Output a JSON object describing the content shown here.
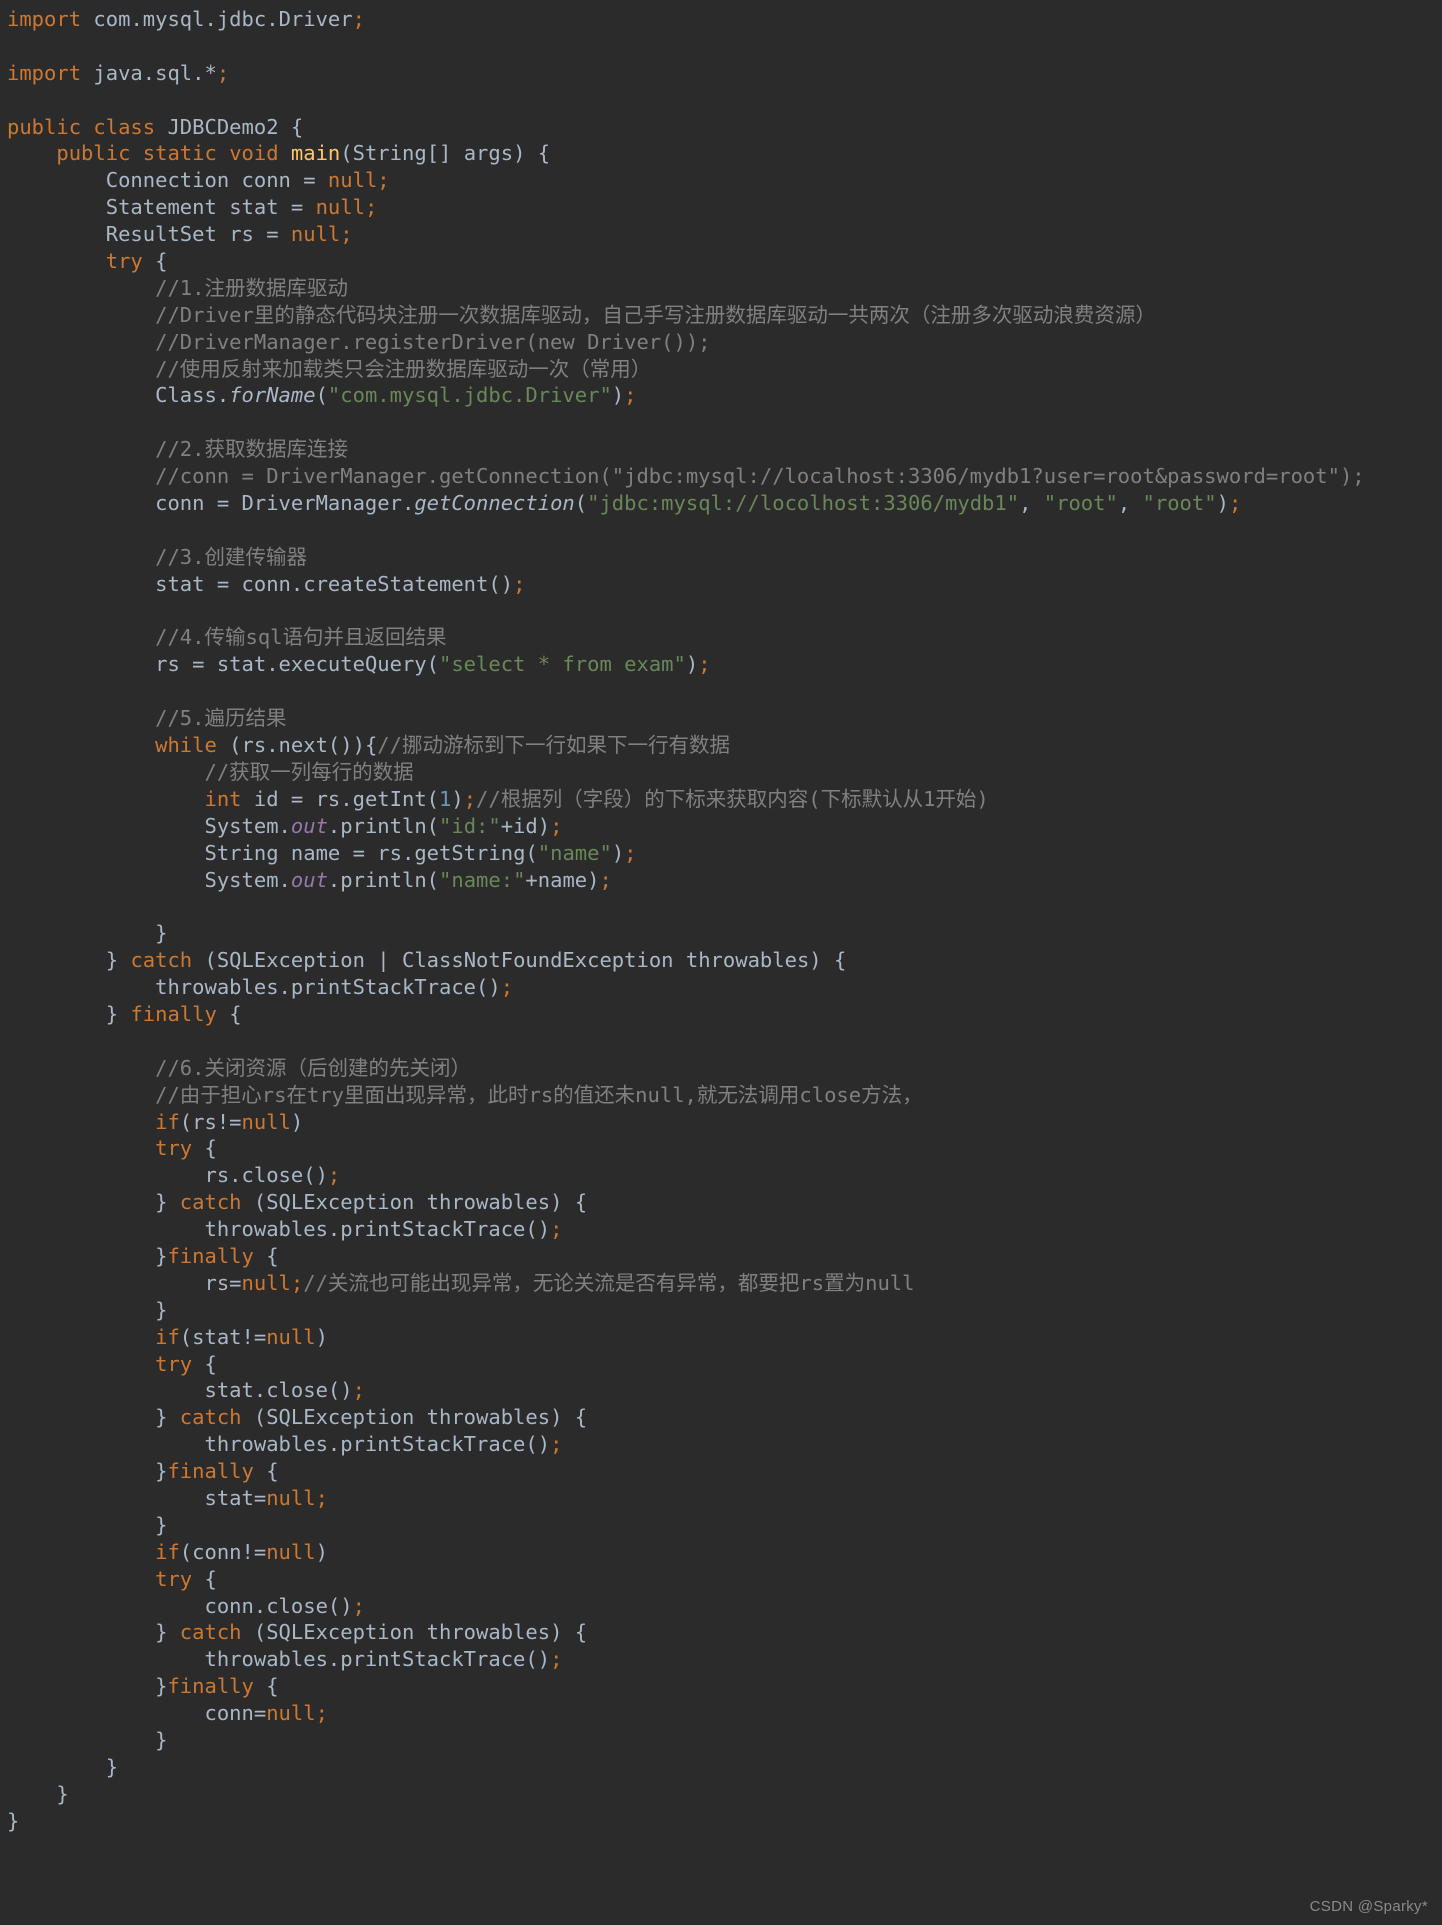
{
  "editor": {
    "language": "java",
    "theme": "darcula",
    "background_color": "#2b2b2b",
    "colors": {
      "default_text": "#a9b7c6",
      "keyword": "#cc7832",
      "string": "#6a8759",
      "comment": "#808080",
      "number": "#6897bb",
      "method_declaration": "#ffc66d",
      "static_field": "#9876aa"
    },
    "lines": [
      {
        "n": 1,
        "text": "import com.mysql.jdbc.Driver;"
      },
      {
        "n": 2,
        "text": ""
      },
      {
        "n": 3,
        "text": "import java.sql.*;"
      },
      {
        "n": 4,
        "text": ""
      },
      {
        "n": 5,
        "text": "public class JDBCDemo2 {"
      },
      {
        "n": 6,
        "text": "    public static void main(String[] args) {"
      },
      {
        "n": 7,
        "text": "        Connection conn = null;"
      },
      {
        "n": 8,
        "text": "        Statement stat = null;"
      },
      {
        "n": 9,
        "text": "        ResultSet rs = null;"
      },
      {
        "n": 10,
        "text": "        try {"
      },
      {
        "n": 11,
        "text": "            //1.注册数据库驱动"
      },
      {
        "n": 12,
        "text": "            //Driver里的静态代码块注册一次数据库驱动，自己手写注册数据库驱动一共两次（注册多次驱动浪费资源）"
      },
      {
        "n": 13,
        "text": "            //DriverManager.registerDriver(new Driver());"
      },
      {
        "n": 14,
        "text": "            //使用反射来加载类只会注册数据库驱动一次（常用）"
      },
      {
        "n": 15,
        "text": "            Class.forName(\"com.mysql.jdbc.Driver\");"
      },
      {
        "n": 16,
        "text": ""
      },
      {
        "n": 17,
        "text": "            //2.获取数据库连接"
      },
      {
        "n": 18,
        "text": "            //conn = DriverManager.getConnection(\"jdbc:mysql://localhost:3306/mydb1?user=root&password=root\");"
      },
      {
        "n": 19,
        "text": "            conn = DriverManager.getConnection(\"jdbc:mysql://locolhost:3306/mydb1\", \"root\", \"root\");"
      },
      {
        "n": 20,
        "text": ""
      },
      {
        "n": 21,
        "text": "            //3.创建传输器"
      },
      {
        "n": 22,
        "text": "            stat = conn.createStatement();"
      },
      {
        "n": 23,
        "text": ""
      },
      {
        "n": 24,
        "text": "            //4.传输sql语句并且返回结果"
      },
      {
        "n": 25,
        "text": "            rs = stat.executeQuery(\"select * from exam\");"
      },
      {
        "n": 26,
        "text": ""
      },
      {
        "n": 27,
        "text": "            //5.遍历结果"
      },
      {
        "n": 28,
        "text": "            while (rs.next()){//挪动游标到下一行如果下一行有数据"
      },
      {
        "n": 29,
        "text": "                //获取一列每行的数据"
      },
      {
        "n": 30,
        "text": "                int id = rs.getInt(1);//根据列（字段）的下标来获取内容(下标默认从1开始)"
      },
      {
        "n": 31,
        "text": "                System.out.println(\"id:\"+id);"
      },
      {
        "n": 32,
        "text": "                String name = rs.getString(\"name\");"
      },
      {
        "n": 33,
        "text": "                System.out.println(\"name:\"+name);"
      },
      {
        "n": 34,
        "text": ""
      },
      {
        "n": 35,
        "text": "            }"
      },
      {
        "n": 36,
        "text": "        } catch (SQLException | ClassNotFoundException throwables) {"
      },
      {
        "n": 37,
        "text": "            throwables.printStackTrace();"
      },
      {
        "n": 38,
        "text": "        } finally {"
      },
      {
        "n": 39,
        "text": ""
      },
      {
        "n": 40,
        "text": "            //6.关闭资源（后创建的先关闭）"
      },
      {
        "n": 41,
        "text": "            //由于担心rs在try里面出现异常，此时rs的值还未null,就无法调用close方法，"
      },
      {
        "n": 42,
        "text": "            if(rs!=null)"
      },
      {
        "n": 43,
        "text": "            try {"
      },
      {
        "n": 44,
        "text": "                rs.close();"
      },
      {
        "n": 45,
        "text": "            } catch (SQLException throwables) {"
      },
      {
        "n": 46,
        "text": "                throwables.printStackTrace();"
      },
      {
        "n": 47,
        "text": "            }finally {"
      },
      {
        "n": 48,
        "text": "                rs=null;//关流也可能出现异常，无论关流是否有异常，都要把rs置为null"
      },
      {
        "n": 49,
        "text": "            }"
      },
      {
        "n": 50,
        "text": "            if(stat!=null)"
      },
      {
        "n": 51,
        "text": "            try {"
      },
      {
        "n": 52,
        "text": "                stat.close();"
      },
      {
        "n": 53,
        "text": "            } catch (SQLException throwables) {"
      },
      {
        "n": 54,
        "text": "                throwables.printStackTrace();"
      },
      {
        "n": 55,
        "text": "            }finally {"
      },
      {
        "n": 56,
        "text": "                stat=null;"
      },
      {
        "n": 57,
        "text": "            }"
      },
      {
        "n": 58,
        "text": "            if(conn!=null)"
      },
      {
        "n": 59,
        "text": "            try {"
      },
      {
        "n": 60,
        "text": "                conn.close();"
      },
      {
        "n": 61,
        "text": "            } catch (SQLException throwables) {"
      },
      {
        "n": 62,
        "text": "                throwables.printStackTrace();"
      },
      {
        "n": 63,
        "text": "            }finally {"
      },
      {
        "n": 64,
        "text": "                conn=null;"
      },
      {
        "n": 65,
        "text": "            }"
      },
      {
        "n": 66,
        "text": "        }"
      },
      {
        "n": 67,
        "text": "    }"
      },
      {
        "n": 68,
        "text": "}"
      }
    ]
  },
  "watermark": {
    "text": "CSDN @Sparky*"
  }
}
